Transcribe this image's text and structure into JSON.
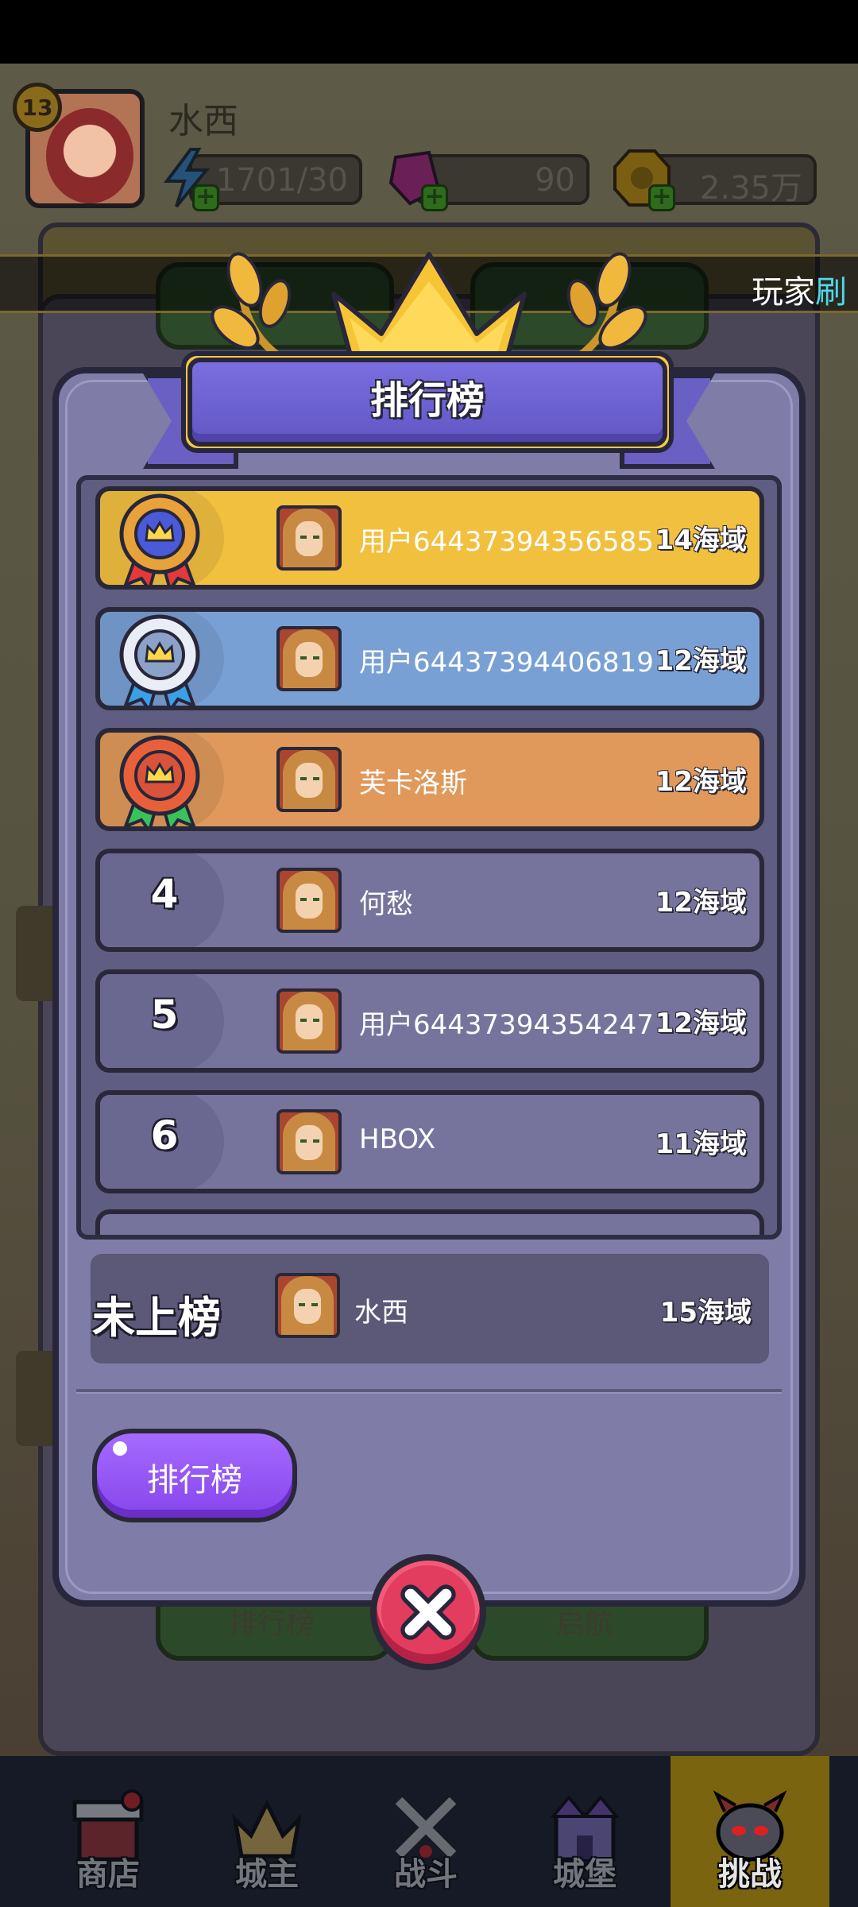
{
  "player": {
    "name": "水西",
    "level": "13",
    "energy": "1701/30",
    "gems": "90",
    "coins": "2.35万"
  },
  "ticker": {
    "text": "玩家",
    "suffix": "刷"
  },
  "background": {
    "button_bottom_left": "排行榜",
    "button_bottom_right": "启航"
  },
  "leaderboard": {
    "title": "排行榜",
    "rows": [
      {
        "rank": "1",
        "name": "用户64437394356585",
        "score": "14海域",
        "bg": "#f2c03f"
      },
      {
        "rank": "2",
        "name": "用户64437394406819",
        "score": "12海域",
        "bg": "#79a0d4"
      },
      {
        "rank": "3",
        "name": "芙卡洛斯",
        "score": "12海域",
        "bg": "#e0995b"
      },
      {
        "rank": "4",
        "name": "何愁",
        "score": "12海域",
        "bg": "#76749c"
      },
      {
        "rank": "5",
        "name": "用户64437394354247",
        "score": "12海域",
        "bg": "#76749c"
      },
      {
        "rank": "6",
        "name": "HBOX",
        "score": "11海域",
        "bg": "#76749c"
      }
    ],
    "me": {
      "rank_text": "未上榜",
      "name": "水西",
      "score": "15海域"
    },
    "tab_label": "排行榜"
  },
  "nav": {
    "items": [
      {
        "label": "商店",
        "icon": "shop-icon"
      },
      {
        "label": "城主",
        "icon": "crown-icon"
      },
      {
        "label": "战斗",
        "icon": "swords-icon"
      },
      {
        "label": "城堡",
        "icon": "castle-icon"
      },
      {
        "label": "挑战",
        "icon": "demon-icon"
      }
    ]
  },
  "colors": {
    "modal_bg": "#7f7ca8",
    "gold": "#f2c03f",
    "silver": "#79a0d4",
    "bronze": "#e0995b",
    "purple_button": "#9a5cf7",
    "close_red": "#e23d5e"
  }
}
